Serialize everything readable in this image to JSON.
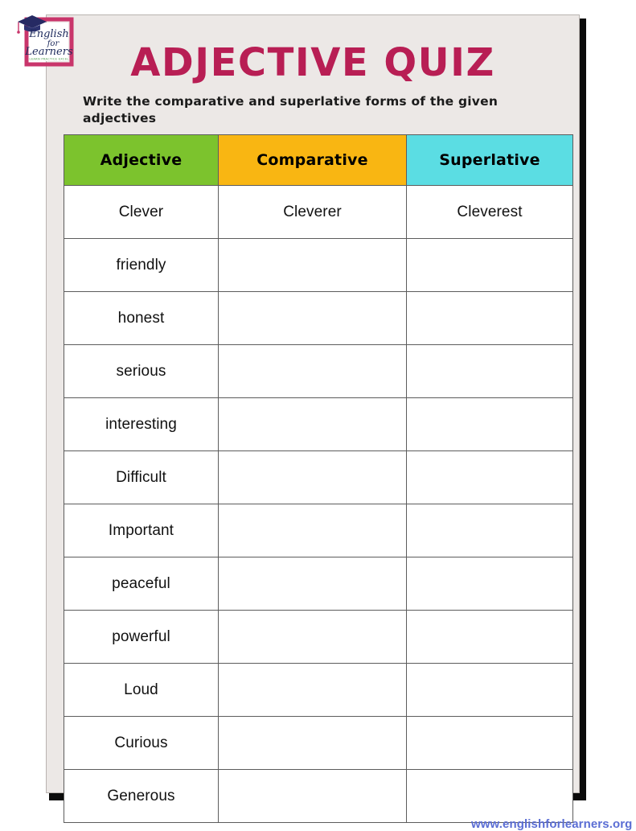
{
  "worksheet": {
    "title": "ADJECTIVE QUIZ",
    "instructions": "Write the comparative and superlative forms of the given adjectives",
    "title_color": "#b81e54"
  },
  "logo": {
    "name": "english-for-learners-logo",
    "line1": "English",
    "line2": "for",
    "line3": "Learners",
    "tagline": "LEARN  PRACTICE  EXCEL",
    "frame_color": "#c9356b",
    "text_color": "#1d2a5c",
    "cap_color": "#262a63",
    "tagline_color": "#4a9a4a"
  },
  "table": {
    "headers": [
      {
        "label": "Adjective",
        "color": "#7cc32d"
      },
      {
        "label": "Comparative",
        "color": "#f9b612"
      },
      {
        "label": "Superlative",
        "color": "#5bdde3"
      }
    ],
    "rows": [
      {
        "adjective": "Clever",
        "comparative": "Cleverer",
        "superlative": "Cleverest"
      },
      {
        "adjective": "friendly",
        "comparative": "",
        "superlative": ""
      },
      {
        "adjective": "honest",
        "comparative": "",
        "superlative": ""
      },
      {
        "adjective": "serious",
        "comparative": "",
        "superlative": ""
      },
      {
        "adjective": "interesting",
        "comparative": "",
        "superlative": ""
      },
      {
        "adjective": "Difficult",
        "comparative": "",
        "superlative": ""
      },
      {
        "adjective": "Important",
        "comparative": "",
        "superlative": ""
      },
      {
        "adjective": "peaceful",
        "comparative": "",
        "superlative": ""
      },
      {
        "adjective": "powerful",
        "comparative": "",
        "superlative": ""
      },
      {
        "adjective": "Loud",
        "comparative": "",
        "superlative": ""
      },
      {
        "adjective": "Curious",
        "comparative": "",
        "superlative": ""
      },
      {
        "adjective": "Generous",
        "comparative": "",
        "superlative": ""
      }
    ]
  },
  "footer": {
    "url": "www.englishforlearners.org",
    "url_color": "#5b6ed4"
  }
}
